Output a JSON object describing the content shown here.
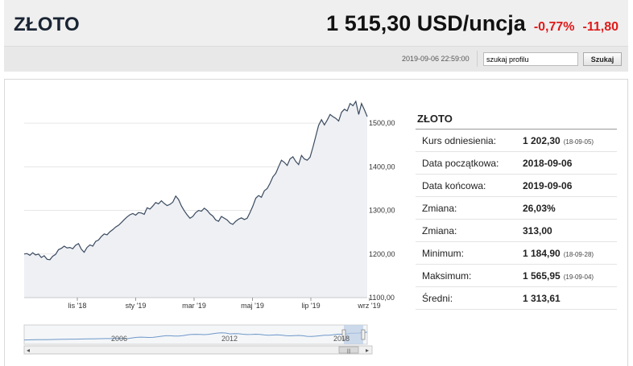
{
  "header": {
    "title": "ZŁOTO",
    "price": "1 515,30 USD/uncja",
    "change_pct": "-0,77%",
    "change_abs": "-11,80",
    "timestamp": "2019-09-06 22:59:00",
    "search_value": "szukaj profilu",
    "search_button": "Szukaj"
  },
  "stats": {
    "title": "ZŁOTO",
    "rows": [
      {
        "label": "Kurs odniesienia:",
        "value": "1 202,30",
        "date": "(18-09-05)"
      },
      {
        "label": "Data początkowa:",
        "value": "2018-09-06",
        "date": ""
      },
      {
        "label": "Data końcowa:",
        "value": "2019-09-06",
        "date": ""
      },
      {
        "label": "Zmiana:",
        "value": "26,03%",
        "date": ""
      },
      {
        "label": "Zmiana:",
        "value": "313,00",
        "date": ""
      },
      {
        "label": "Minimum:",
        "value": "1 184,90",
        "date": "(18-09-28)"
      },
      {
        "label": "Maksimum:",
        "value": "1 565,95",
        "date": "(19-09-04)"
      },
      {
        "label": "Średni:",
        "value": "1 313,61",
        "date": ""
      }
    ]
  },
  "chart_data": {
    "type": "area",
    "title": "",
    "xlabel": "",
    "ylabel": "",
    "x_tick_labels": [
      "lis '18",
      "sty '19",
      "mar '19",
      "maj '19",
      "lip '19",
      "wrz '19"
    ],
    "y_tick_labels": [
      "1100,00",
      "1200,00",
      "1300,00",
      "1400,00",
      "1500,00"
    ],
    "ylim": [
      1100,
      1550
    ],
    "grid": true,
    "series": [
      {
        "values": [
          1200,
          1201,
          1197,
          1203,
          1198,
          1200,
          1192,
          1196,
          1188,
          1187,
          1195,
          1199,
          1210,
          1213,
          1218,
          1214,
          1215,
          1212,
          1220,
          1224,
          1211,
          1204,
          1215,
          1221,
          1218,
          1229,
          1232,
          1240,
          1246,
          1244,
          1251,
          1256,
          1262,
          1266,
          1272,
          1279,
          1285,
          1290,
          1293,
          1289,
          1295,
          1294,
          1291,
          1306,
          1303,
          1310,
          1318,
          1315,
          1322,
          1316,
          1311,
          1314,
          1319,
          1333,
          1325,
          1310,
          1299,
          1290,
          1282,
          1286,
          1295,
          1300,
          1298,
          1305,
          1300,
          1292,
          1287,
          1278,
          1275,
          1286,
          1282,
          1278,
          1271,
          1268,
          1275,
          1280,
          1283,
          1279,
          1282,
          1295,
          1310,
          1328,
          1334,
          1330,
          1345,
          1350,
          1362,
          1377,
          1385,
          1400,
          1415,
          1410,
          1403,
          1418,
          1423,
          1412,
          1405,
          1426,
          1418,
          1415,
          1422,
          1445,
          1470,
          1495,
          1508,
          1496,
          1507,
          1520,
          1515,
          1511,
          1505,
          1525,
          1532,
          1528,
          1545,
          1540,
          1550,
          1520,
          1545,
          1531,
          1515
        ]
      }
    ],
    "navigator": {
      "x_tick_labels": [
        "2006",
        "2012",
        "2018"
      ]
    }
  },
  "colors": {
    "line": "#3a4a5f",
    "area": "#eef0f4",
    "accent_negative": "#e01a1a",
    "navigator_line": "#6f98c9",
    "navigator_selection": "#b9cde6"
  }
}
